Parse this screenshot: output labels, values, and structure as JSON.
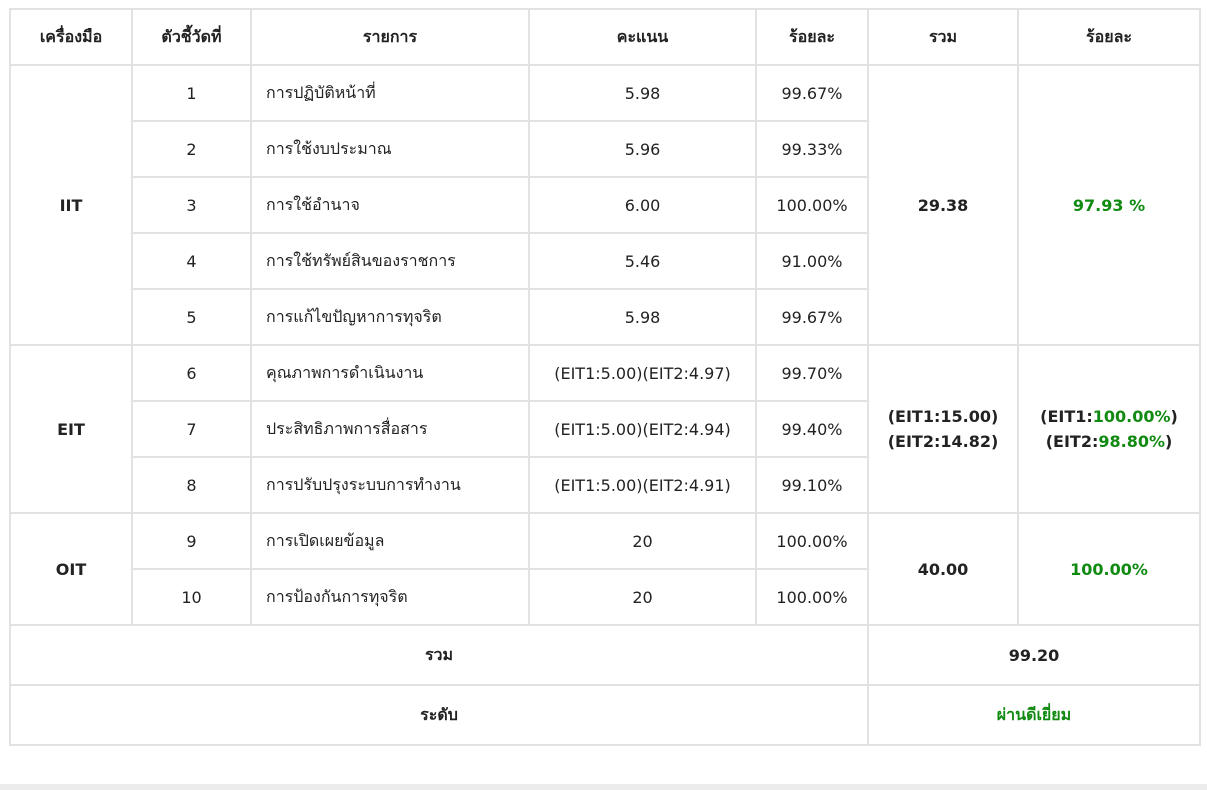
{
  "headers": [
    "เครื่องมือ",
    "ตัวชี้วัดที่",
    "รายการ",
    "คะแนน",
    "ร้อยละ",
    "รวม",
    "ร้อยละ"
  ],
  "groups": {
    "iit": {
      "tool": "IIT",
      "total": "29.38",
      "percent": "97.93 %",
      "rows": [
        {
          "no": "1",
          "item": "การปฏิบัติหน้าที่",
          "score": "5.98",
          "pct": "99.67%"
        },
        {
          "no": "2",
          "item": "การใช้งบประมาณ",
          "score": "5.96",
          "pct": "99.33%"
        },
        {
          "no": "3",
          "item": "การใช้อำนาจ",
          "score": "6.00",
          "pct": "100.00%"
        },
        {
          "no": "4",
          "item": "การใช้ทรัพย์สินของราชการ",
          "score": "5.46",
          "pct": "91.00%"
        },
        {
          "no": "5",
          "item": "การแก้ไขปัญหาการทุจริต",
          "score": "5.98",
          "pct": "99.67%"
        }
      ]
    },
    "eit": {
      "tool": "EIT",
      "total_line1": "(EIT1:15.00)",
      "total_line2": "(EIT2:14.82)",
      "pct1_prefix": "(EIT1:",
      "pct1_value": "100.00%",
      "pct2_prefix": "(EIT2:",
      "pct2_value": "98.80%",
      "close": ")",
      "rows": [
        {
          "no": "6",
          "item": "คุณภาพการดำเนินงาน",
          "score": "(EIT1:5.00)(EIT2:4.97)",
          "pct": "99.70%"
        },
        {
          "no": "7",
          "item": "ประสิทธิภาพการสื่อสาร",
          "score": "(EIT1:5.00)(EIT2:4.94)",
          "pct": "99.40%"
        },
        {
          "no": "8",
          "item": "การปรับปรุงระบบการทำงาน",
          "score": "(EIT1:5.00)(EIT2:4.91)",
          "pct": "99.10%"
        }
      ]
    },
    "oit": {
      "tool": "OIT",
      "total": "40.00",
      "percent": "100.00%",
      "rows": [
        {
          "no": "9",
          "item": "การเปิดเผยข้อมูล",
          "score": "20",
          "pct": "100.00%"
        },
        {
          "no": "10",
          "item": "การป้องกันการทุจริต",
          "score": "20",
          "pct": "100.00%"
        }
      ]
    }
  },
  "footer": {
    "total_label": "รวม",
    "total_value": "99.20",
    "level_label": "ระดับ",
    "level_value": "ผ่านดีเยี่ยม"
  },
  "colors": {
    "accent_green": "#118a12",
    "border": "#e2e2e2"
  }
}
